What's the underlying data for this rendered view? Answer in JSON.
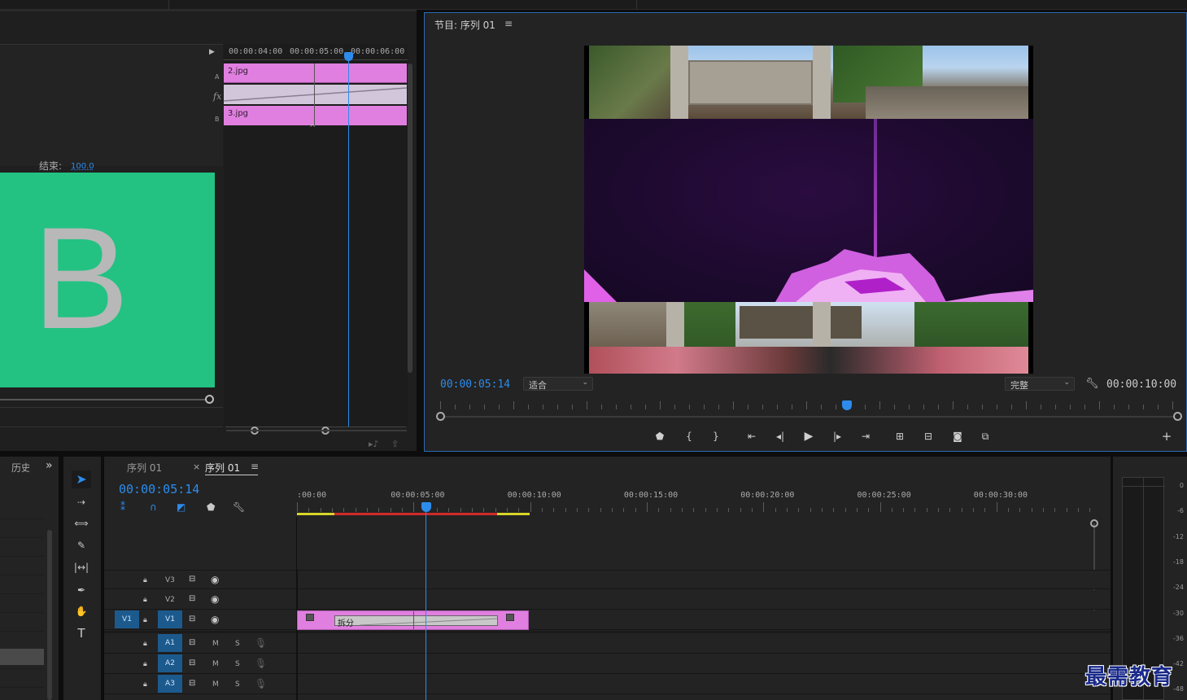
{
  "effect_controls": {
    "ruler_ticks": [
      "00:00:04:00",
      "00:00:05:00",
      "00:00:06:00"
    ],
    "clip_a": "2.jpg",
    "clip_b": "3.jpg",
    "row_a": "A",
    "row_fx": "fx",
    "row_b": "B",
    "end_label": "结束:",
    "end_value": "100.0",
    "preview_letter": "B"
  },
  "program_monitor": {
    "title": "节目: 序列 01",
    "menu_icon": "≡",
    "timecode": "00:00:05:14",
    "fit_select": "适合",
    "quality_select": "完整",
    "duration": "00:00:10:00",
    "playhead_position": 0.52
  },
  "history_panel": {
    "tab_label": "历史",
    "more_icon": "»"
  },
  "timeline": {
    "tabs": [
      {
        "label": "序列 01",
        "close": "×"
      },
      {
        "label": "序列 01",
        "menu": "≡"
      }
    ],
    "timecode": "00:00:05:14",
    "ruler_labels": [
      ":00:00",
      "00:00:05:00",
      "00:00:10:00",
      "00:00:15:00",
      "00:00:20:00",
      "00:00:25:00",
      "00:00:30:00"
    ],
    "video_tracks": [
      {
        "name": "V3",
        "source": ""
      },
      {
        "name": "V2",
        "source": ""
      },
      {
        "name": "V1",
        "source": "V1"
      }
    ],
    "audio_tracks": [
      {
        "name": "A1",
        "m": "M",
        "s": "S"
      },
      {
        "name": "A2",
        "m": "M",
        "s": "S"
      },
      {
        "name": "A3",
        "m": "M",
        "s": "S"
      }
    ],
    "transition_label": "拆分",
    "tool_type_label": "T"
  },
  "audio_meter": {
    "scale": [
      "0",
      "-6",
      "-12",
      "-18",
      "-24",
      "-30",
      "-36",
      "-42",
      "-48"
    ]
  },
  "watermark": "最需教育",
  "colors": {
    "accent_blue": "#2d8ceb",
    "clip_pink": "#e07fe0",
    "track_blue": "#1c5a8e",
    "green_preview": "#23c282"
  }
}
